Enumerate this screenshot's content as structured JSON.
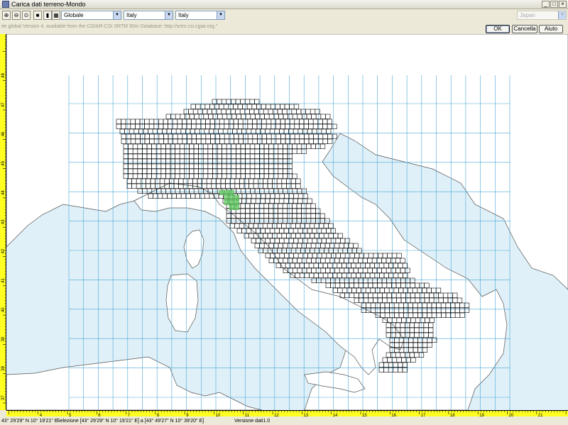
{
  "window": {
    "title": "Carica dati terreno-Mondo",
    "minimize": "_",
    "maximize": "□",
    "close": "×"
  },
  "toolbar": {
    "zoom_in_icon": "magnifier-plus-icon",
    "zoom_out_icon": "magnifier-minus-icon",
    "combo1": "Globale",
    "combo2": "Italy",
    "combo3": "Italy",
    "combo4": "Japan"
  },
  "info_text": "ite global Version 4, available from the CGIAR-CSI SRTM 90m Database: http://srtm.csi.cgiar.org.\"",
  "buttons": {
    "ok": "OK",
    "cancel": "Cancella",
    "help": "Aiuto"
  },
  "ruler": {
    "x_labels": [
      "4",
      "5",
      "6",
      "7",
      "8",
      "9",
      "10",
      "11",
      "12",
      "13",
      "14",
      "15",
      "16",
      "17",
      "18",
      "19",
      "20",
      "21"
    ],
    "y_labels": [
      "37",
      "38",
      "39",
      "40",
      "41",
      "42",
      "43",
      "44",
      "45",
      "46",
      "47",
      "48"
    ]
  },
  "status": {
    "position": "43°  29'29\" N 10°  19'21\" E",
    "selection": "Selezione [43°  29'29\" N 10°  19'21\" E] a [43°  49'27\" N 10°  39'20\" E]",
    "version": "Versione dati1.0"
  },
  "colors": {
    "sea": "#dff0f8",
    "grid": "#4aa8d6",
    "tile": "#000000",
    "selected": "#6ccf6c",
    "ruler": "#ffff22"
  }
}
